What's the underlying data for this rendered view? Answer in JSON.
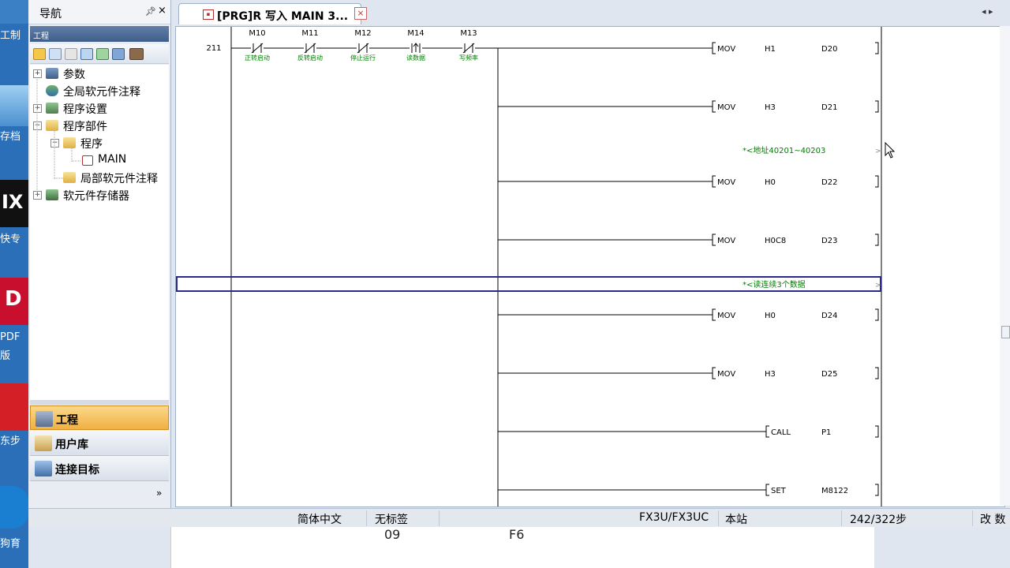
{
  "desktop": {
    "labels": [
      "工制",
      "存档",
      "快专",
      "PDF",
      "版",
      "东步",
      "狗育"
    ],
    "tile_text": [
      "IX",
      "D"
    ]
  },
  "nav": {
    "title": "导航",
    "pin_icon": "pin-icon",
    "close_glyph": "×",
    "project_header": "工程",
    "tree": [
      {
        "label": "参数",
        "icon": "parameter-icon",
        "expander": "+"
      },
      {
        "label": "全局软元件注释",
        "icon": "global-comment-icon",
        "expander": ""
      },
      {
        "label": "程序设置",
        "icon": "program-setting-icon",
        "expander": "+"
      },
      {
        "label": "程序部件",
        "icon": "folder-icon",
        "expander": "−"
      },
      {
        "label": "程序",
        "icon": "folder-icon",
        "expander": "−"
      },
      {
        "label": "MAIN",
        "icon": "program-file-icon",
        "expander": ""
      },
      {
        "label": "局部软元件注释",
        "icon": "folder-icon",
        "expander": ""
      },
      {
        "label": "软元件存储器",
        "icon": "device-memory-icon",
        "expander": "+"
      }
    ],
    "buttons": {
      "project": "工程",
      "library": "用户库",
      "connection": "连接目标"
    },
    "more_glyph": "»"
  },
  "editor": {
    "tab_title": "[PRG]R 写入 MAIN 3...",
    "tab_close": "×",
    "scroll_arrows": "◂ ▸",
    "step": "211",
    "contacts": [
      {
        "device": "M10",
        "comment": "正转启动",
        "kind": "nc"
      },
      {
        "device": "M11",
        "comment": "反转启动",
        "kind": "nc"
      },
      {
        "device": "M12",
        "comment": "停止运行",
        "kind": "nc"
      },
      {
        "device": "M14",
        "comment": "读数据",
        "kind": "pulse"
      },
      {
        "device": "M13",
        "comment": "写频率",
        "kind": "nc"
      }
    ],
    "rows": [
      {
        "type": "instr",
        "op": "MOV",
        "a": "H1",
        "b": "D20"
      },
      {
        "type": "instr",
        "op": "MOV",
        "a": "H3",
        "b": "D21"
      },
      {
        "type": "comment",
        "text": "*<地址40201~40203"
      },
      {
        "type": "instr",
        "op": "MOV",
        "a": "H0",
        "b": "D22"
      },
      {
        "type": "instr",
        "op": "MOV",
        "a": "H0C8",
        "b": "D23"
      },
      {
        "type": "comment",
        "text": "*<读连续3个数据",
        "selected": true
      },
      {
        "type": "instr",
        "op": "MOV",
        "a": "H0",
        "b": "D24"
      },
      {
        "type": "instr",
        "op": "MOV",
        "a": "H3",
        "b": "D25"
      },
      {
        "type": "instr",
        "op": "CALL",
        "a": "P1",
        "b": ""
      },
      {
        "type": "instr",
        "op": "SET",
        "a": "M8122",
        "b": ""
      }
    ],
    "comment_close": ">"
  },
  "status": {
    "language": "简体中文",
    "label": "无标签",
    "plc_model": "FX3U/FX3UC",
    "station": "本站",
    "steps": "242/322步",
    "mode": "改 数"
  },
  "background": {
    "text_left": "09",
    "text_right": "F6"
  },
  "colors": {
    "ladder_line": "#000000",
    "comment_green": "#008000",
    "selection": "#2a2a8a",
    "active_button": "#f0b042"
  }
}
